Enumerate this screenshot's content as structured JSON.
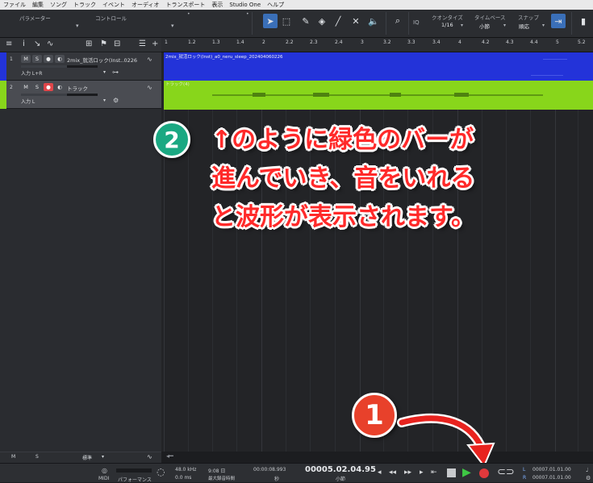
{
  "menubar": {
    "items": [
      "ファイル",
      "編集",
      "ソング",
      "トラック",
      "イベント",
      "オーディオ",
      "トランスポート",
      "表示",
      "Studio One",
      "ヘルプ"
    ]
  },
  "toolbar": {
    "parameters_label": "パラメーター",
    "control_label": "コントロール",
    "iq_label": "IQ",
    "quantize_label": "クオンタイズ",
    "quantize_value": "1/16",
    "timebase_label": "タイムベース",
    "timebase_value": "小節",
    "snap_label": "スナップ",
    "snap_value": "順応"
  },
  "tracks": [
    {
      "number": "1",
      "mute": "M",
      "solo": "S",
      "name": "2mix_就活ロック(Inst..0226",
      "input": "入力 L+R",
      "color": "#2333d9",
      "record_armed": false
    },
    {
      "number": "2",
      "mute": "M",
      "solo": "S",
      "name": "トラック",
      "input": "入力 L",
      "color": "#88d61b",
      "record_armed": true
    }
  ],
  "track_panel_bottom": {
    "m": "M",
    "s": "S",
    "preset": "標準"
  },
  "ruler": {
    "labels": [
      "1",
      "1.2",
      "1.3",
      "1.4",
      "2",
      "2.2",
      "2.3",
      "2.4",
      "3",
      "3.2",
      "3.3",
      "3.4",
      "4",
      "4.2",
      "4.3",
      "4.4",
      "5",
      "5.2"
    ]
  },
  "clips": {
    "blue_title": "2mix_就活ロック(Inst)_a0_neru_sleep_202404060226",
    "green_title": "トラック(4)"
  },
  "annotations": {
    "badge1": "1",
    "badge2": "2",
    "line1": "↑のように緑色のバーが",
    "line2": "進んでいき、音をいれる",
    "line3": "と波形が表示されます。",
    "annotation_color": "#ff2a2a",
    "badge1_color": "#e8412b",
    "badge2_color": "#1aa882"
  },
  "transport": {
    "midi_label": "MIDI",
    "performance_label": "パフォーマンス",
    "sample_rate": "48.0 kHz",
    "latency": "0.0 ms",
    "record_time": "9:08 日",
    "record_time_label": "最大録音時間",
    "seconds_time": "00:00:08.993",
    "seconds_label": "秒",
    "position": "00005.02.04.95",
    "position_label": "小節",
    "left_locator_label": "L",
    "left_locator": "00007.01.01.00",
    "right_locator_label": "R",
    "right_locator": "00007.01.01.00"
  }
}
